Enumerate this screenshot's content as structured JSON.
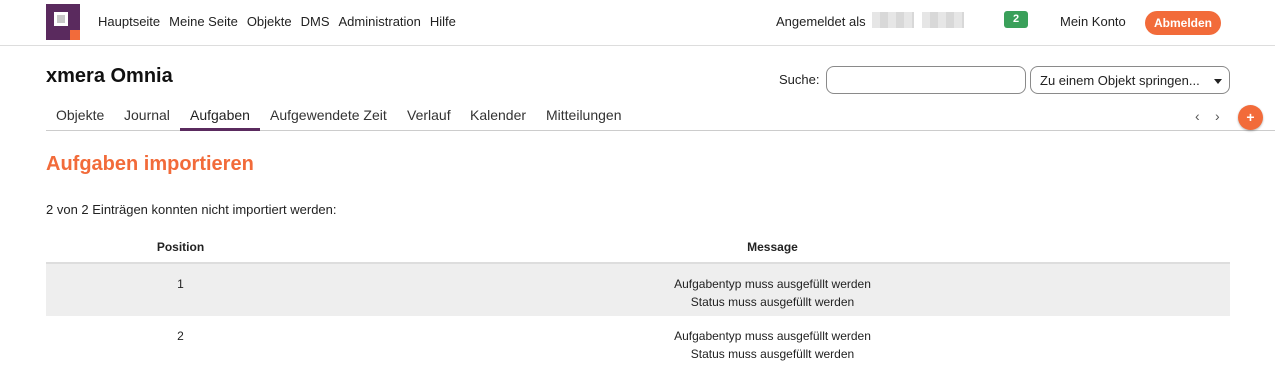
{
  "topbar": {
    "menu": [
      "Hauptseite",
      "Meine Seite",
      "Objekte",
      "DMS",
      "Administration",
      "Hilfe"
    ],
    "logged_in_label": "Angemeldet als",
    "notification_count": "2",
    "my_account": "Mein Konto",
    "logout": "Abmelden"
  },
  "header": {
    "project_name": "xmera Omnia",
    "search_label": "Suche:",
    "search_value": "",
    "jump_label": "Zu einem Objekt springen..."
  },
  "tabs": [
    {
      "label": "Objekte",
      "active": false
    },
    {
      "label": "Journal",
      "active": false
    },
    {
      "label": "Aufgaben",
      "active": true
    },
    {
      "label": "Aufgewendete Zeit",
      "active": false
    },
    {
      "label": "Verlauf",
      "active": false
    },
    {
      "label": "Kalender",
      "active": false
    },
    {
      "label": "Mitteilungen",
      "active": false
    }
  ],
  "tab_nav": {
    "prev": "‹",
    "next": "›",
    "add": "+"
  },
  "content": {
    "heading": "Aufgaben importieren",
    "summary": "2 von 2 Einträgen konnten nicht importiert werden:",
    "columns": [
      "Position",
      "Message"
    ],
    "rows": [
      {
        "position": "1",
        "messages": [
          "Aufgabentyp muss ausgefüllt werden",
          "Status muss ausgefüllt werden"
        ]
      },
      {
        "position": "2",
        "messages": [
          "Aufgabentyp muss ausgefüllt werden",
          "Status muss ausgefüllt werden"
        ]
      }
    ]
  },
  "colors": {
    "brand_purple": "#5a2a5e",
    "accent_orange": "#f26b3a",
    "badge_green": "#3aa05a",
    "row_stripe": "#eeeeee"
  }
}
